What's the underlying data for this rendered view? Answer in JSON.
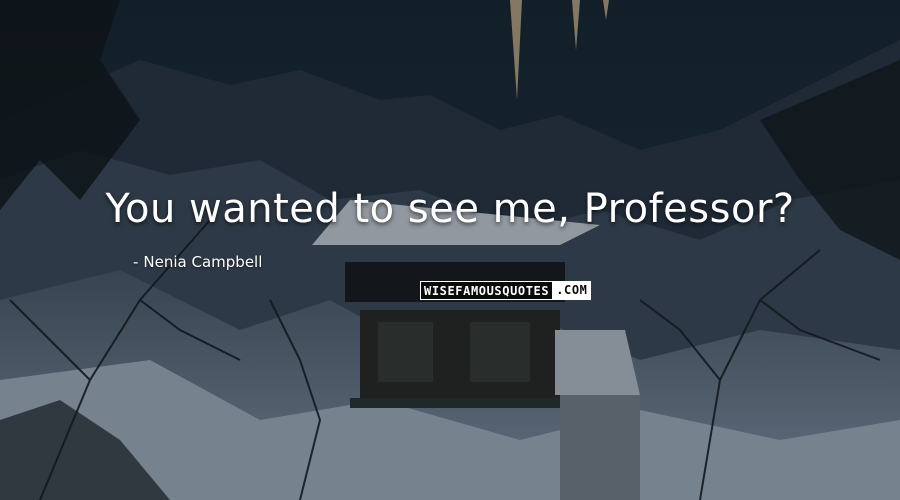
{
  "quote": {
    "text": "You wanted to see me, Professor?",
    "author_dash": "-",
    "author": "Nenia Campbell"
  },
  "watermark": {
    "site_main": "WISEFAMOUSQUOTES",
    "site_suffix": ".COM"
  },
  "background": {
    "scene": "snowy-mountain-cabin",
    "sky_color": "#1d2f3b",
    "snow_color": "#9fb0c0",
    "shadow_color": "#0f151b"
  }
}
